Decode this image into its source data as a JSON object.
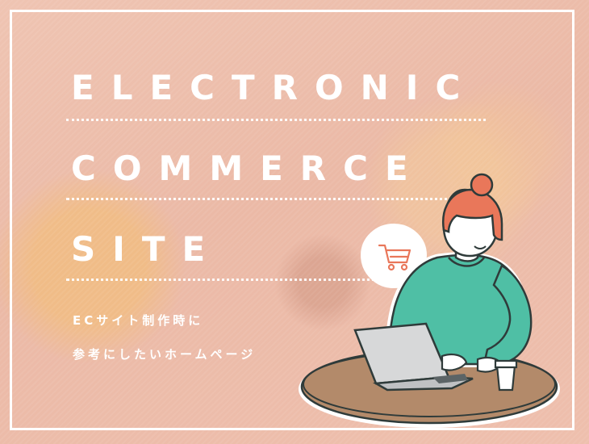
{
  "title_lines": [
    "ELECTRONIC",
    "COMMERCE",
    "SITE"
  ],
  "subtitle_lines": [
    "ECサイト制作時に",
    "参考にしたいホームページ"
  ],
  "icons": [
    "shopping-cart-icon"
  ],
  "colors": {
    "background": "#eec0ae",
    "text": "#ffffff",
    "sweater": "#4fbfa5",
    "hair": "#e9775a",
    "table": "#b38a6a",
    "cart": "#e9775a"
  }
}
